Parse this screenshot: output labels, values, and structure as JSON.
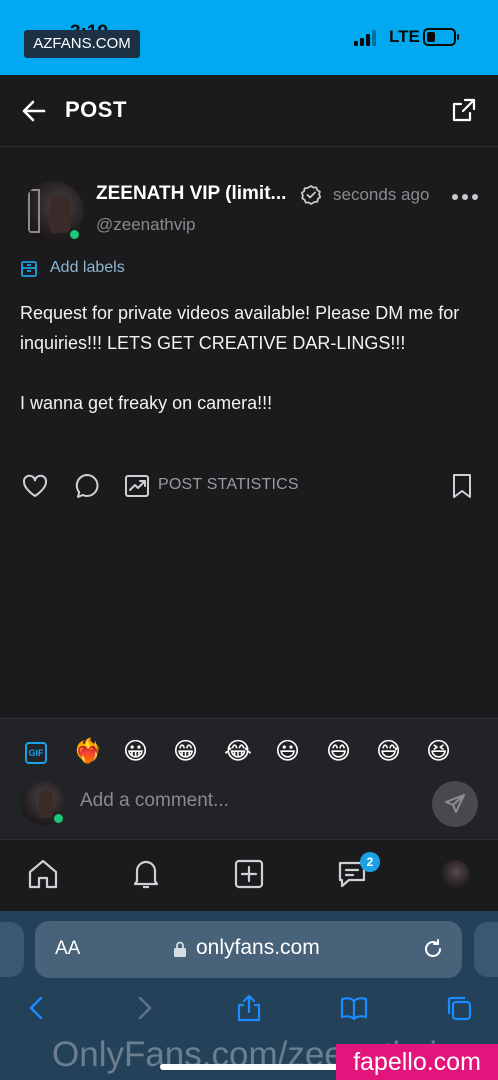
{
  "status_bar": {
    "time": "3:19",
    "network": "LTE",
    "overlay_watermark": "AZFANS.COM"
  },
  "header": {
    "title": "POST"
  },
  "post": {
    "author_name": "ZEENATH VIP (limit...",
    "author_handle": "@zeenathvip",
    "time": "seconds ago",
    "add_labels": "Add labels",
    "text_para1": "Request for private videos available! Please DM me for inquiries!!! LETS GET CREATIVE DAR-LINGS!!!",
    "text_para2": "I wanna get freaky on camera!!!",
    "stats_label": "POST STATISTICS"
  },
  "emoji_bar": {
    "gif_label": "GIF",
    "emojis": [
      "❤️‍🔥",
      "😀",
      "😁",
      "😂",
      "😃",
      "😄",
      "😅",
      "😆"
    ]
  },
  "comment": {
    "placeholder": "Add a comment..."
  },
  "nav": {
    "messages_badge": "2",
    "icons": [
      "home-icon",
      "bell-icon",
      "plus-square-icon",
      "message-icon",
      "avatar"
    ]
  },
  "browser": {
    "aa_label": "AA",
    "url": "onlyfans.com",
    "watermark": "OnlyFans.com/zeenathvip",
    "site_badge": "fapello.com"
  },
  "colors": {
    "accent": "#00aff0",
    "background": "#1b1b1d",
    "online": "#1ec773",
    "badge": "#1aa1e5"
  }
}
